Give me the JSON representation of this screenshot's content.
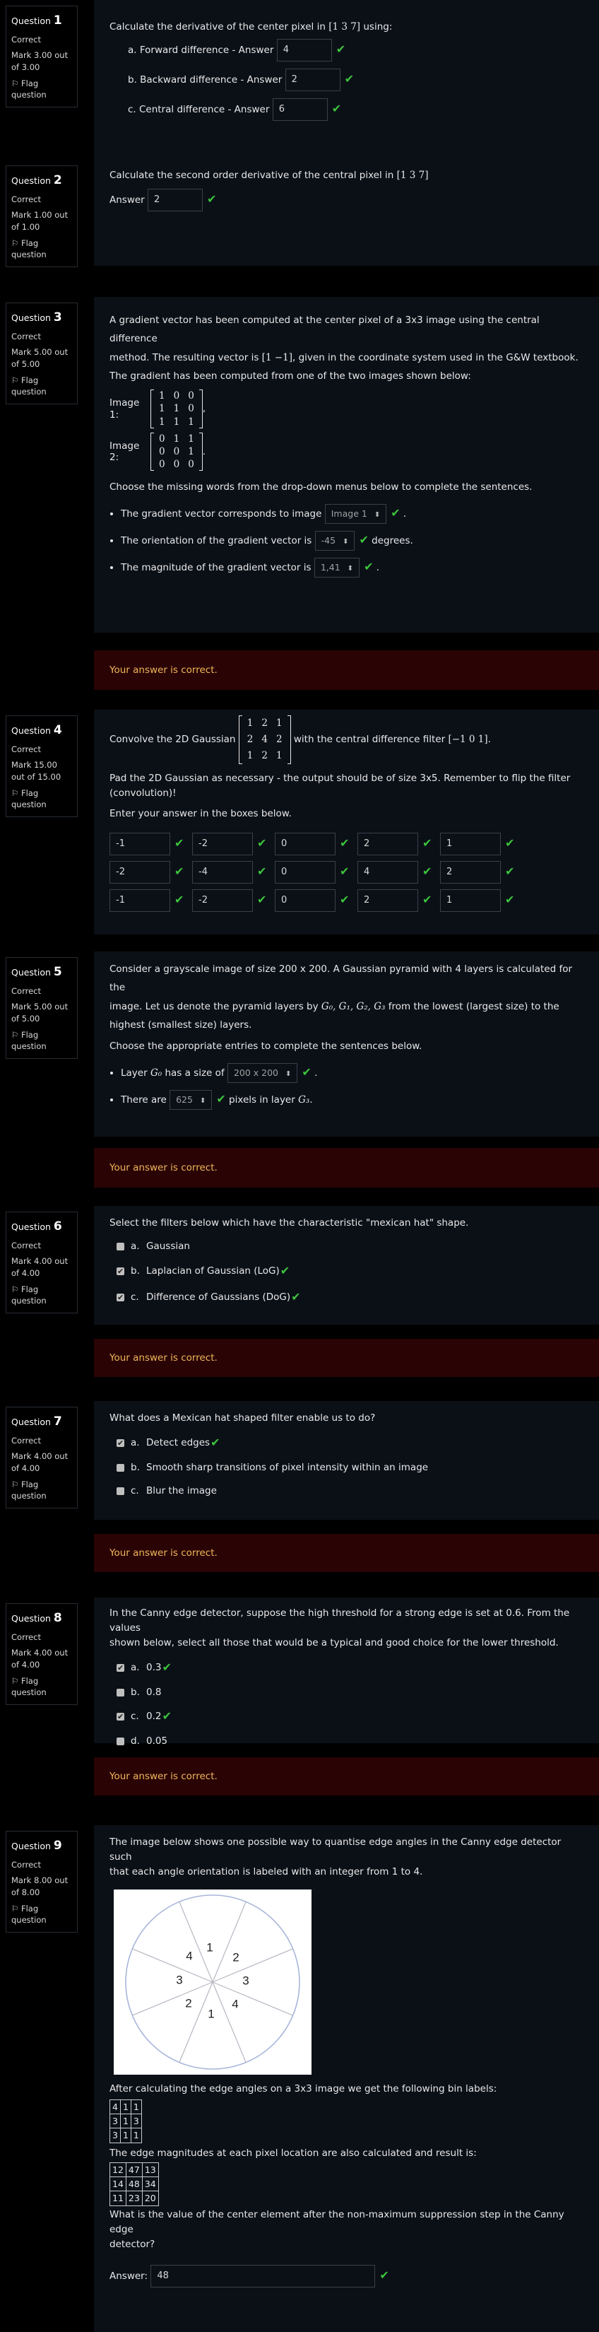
{
  "common": {
    "state_correct": "Correct",
    "flag": "Flag question",
    "feedback": "Your answer is correct.",
    "question": "Question"
  },
  "q1": {
    "no": "1",
    "mark": "Mark 3.00 out of 3.00",
    "prompt_pre": "Calculate the derivative of the center pixel in",
    "prompt_vec": "[1  3  7]",
    "prompt_post": "using:",
    "items": [
      {
        "label": "a. Forward difference - Answer",
        "value": "4"
      },
      {
        "label": "b. Backward difference - Answer",
        "value": "2"
      },
      {
        "label": "c. Central difference - Answer",
        "value": "6"
      }
    ]
  },
  "q2": {
    "no": "2",
    "mark": "Mark 1.00 out of 1.00",
    "prompt_pre": "Calculate the second order derivative of the central pixel in",
    "prompt_vec": "[1  3  7]",
    "answer_label": "Answer",
    "answer": "2"
  },
  "q3": {
    "no": "3",
    "mark": "Mark 5.00 out of 5.00",
    "p1a": "A gradient vector has been computed at the center pixel of a 3x3 image using the central difference",
    "p1b": "method. The resulting vector is",
    "p1vec": "[1  −1]",
    "p1c": ", given in the coordinate system used in the G&W textbook.",
    "p2": "The gradient has been computed from one of the two images shown below:",
    "img1_label": "Image 1:",
    "img1": [
      [
        "1",
        "0",
        "0"
      ],
      [
        "1",
        "1",
        "0"
      ],
      [
        "1",
        "1",
        "1"
      ]
    ],
    "img1_end": ",",
    "img2_label": "Image 2:",
    "img2": [
      [
        "0",
        "1",
        "1"
      ],
      [
        "0",
        "0",
        "1"
      ],
      [
        "0",
        "0",
        "0"
      ]
    ],
    "img2_end": ".",
    "p3": "Choose the missing words from the drop-down menus below to complete the sentences.",
    "s1_pre": "The gradient vector corresponds to image",
    "s1_sel": "Image 1",
    "s1_post": ".",
    "s2_pre": "The orientation of the gradient vector is",
    "s2_sel": "-45",
    "s2_post": "degrees.",
    "s3_pre": "The magnitude of the gradient vector is",
    "s3_sel": "1,41",
    "s3_post": "."
  },
  "q4": {
    "no": "4",
    "mark": "Mark 15.00 out of 15.00",
    "p1_pre": "Convolve the 2D Gaussian",
    "gauss": [
      [
        "1",
        "2",
        "1"
      ],
      [
        "2",
        "4",
        "2"
      ],
      [
        "1",
        "2",
        "1"
      ]
    ],
    "p1_mid": "with the central difference filter",
    "filter": "[−1  0  1]",
    "p1_end": ".",
    "p2": "Pad the 2D Gaussian as necessary - the output should be of size 3x5. Remember to flip the filter (convolution)!",
    "p3": "Enter your answer in the boxes below.",
    "rows": [
      [
        "-1",
        "-2",
        "0",
        "2",
        "1"
      ],
      [
        "-2",
        "-4",
        "0",
        "4",
        "2"
      ],
      [
        "-1",
        "-2",
        "0",
        "2",
        "1"
      ]
    ]
  },
  "q5": {
    "no": "5",
    "mark": "Mark 5.00 out of 5.00",
    "p1a": "Consider a grayscale image of size 200 x 200. A Gaussian pyramid with 4 layers is calculated for the",
    "p1b": "image. Let us denote the pyramid layers by",
    "layers": "G₀, G₁, G₂, G₃",
    "p1c": "from the lowest (largest size) to the",
    "p1d": "highest (smallest size) layers.",
    "p2": "Choose the appropriate entries to complete the sentences below.",
    "s1_pre": "Layer",
    "s1_var": "G₀",
    "s1_mid": "has a size of",
    "s1_sel": "200 x 200",
    "s1_post": ".",
    "s2_pre": "There are",
    "s2_sel": "625",
    "s2_mid": "pixels in layer",
    "s2_var": "G₃",
    "s2_post": "."
  },
  "q6": {
    "no": "6",
    "mark": "Mark 4.00 out of 4.00",
    "prompt": "Select the filters below which have the characteristic \"mexican hat\" shape.",
    "options": [
      {
        "letter": "a.",
        "text": "Gaussian",
        "checked": false,
        "ok": false
      },
      {
        "letter": "b.",
        "text": "Laplacian of Gaussian (LoG)",
        "checked": true,
        "ok": true
      },
      {
        "letter": "c.",
        "text": "Difference of Gaussians (DoG)",
        "checked": true,
        "ok": true
      }
    ]
  },
  "q7": {
    "no": "7",
    "mark": "Mark 4.00 out of 4.00",
    "prompt": "What does a Mexican hat shaped filter enable us to do?",
    "options": [
      {
        "letter": "a.",
        "text": "Detect edges",
        "checked": true,
        "ok": true
      },
      {
        "letter": "b.",
        "text": "Smooth sharp transitions of pixel intensity within an image",
        "checked": false,
        "ok": false
      },
      {
        "letter": "c.",
        "text": "Blur the image",
        "checked": false,
        "ok": false
      }
    ]
  },
  "q8": {
    "no": "8",
    "mark": "Mark 4.00 out of 4.00",
    "prompt_a": "In the Canny edge detector, suppose the high threshold for a strong edge is set at 0.6. From the values",
    "prompt_b": "shown below, select all those that would be a typical and good choice for the lower threshold.",
    "options": [
      {
        "letter": "a.",
        "text": "0.3",
        "checked": true,
        "ok": true
      },
      {
        "letter": "b.",
        "text": "0.8",
        "checked": false,
        "ok": false
      },
      {
        "letter": "c.",
        "text": "0.2",
        "checked": true,
        "ok": true
      },
      {
        "letter": "d.",
        "text": "0.05",
        "checked": false,
        "ok": false
      }
    ]
  },
  "q9": {
    "no": "9",
    "mark": "Mark 8.00 out of 8.00",
    "p1a": "The image below shows one possible way to quantise edge angles in the Canny edge detector such",
    "p1b": "that each angle orientation is labeled with an integer from 1 to 4.",
    "wheel_labels": [
      "1",
      "2",
      "3",
      "4",
      "1",
      "2",
      "3",
      "4"
    ],
    "p2": "After calculating the edge angles on a 3x3 image we get the following bin labels:",
    "bins": [
      [
        "4",
        "1",
        "1"
      ],
      [
        "3",
        "1",
        "3"
      ],
      [
        "3",
        "1",
        "1"
      ]
    ],
    "p3": "The edge magnitudes at each pixel location are also calculated and result is:",
    "mags": [
      [
        "12",
        "47",
        "13"
      ],
      [
        "14",
        "48",
        "34"
      ],
      [
        "11",
        "23",
        "20"
      ]
    ],
    "p4a": "What is the value of the center element after the non-maximum suppression step in the Canny edge",
    "p4b": "detector?",
    "answer_label": "Answer:",
    "answer": "48"
  }
}
